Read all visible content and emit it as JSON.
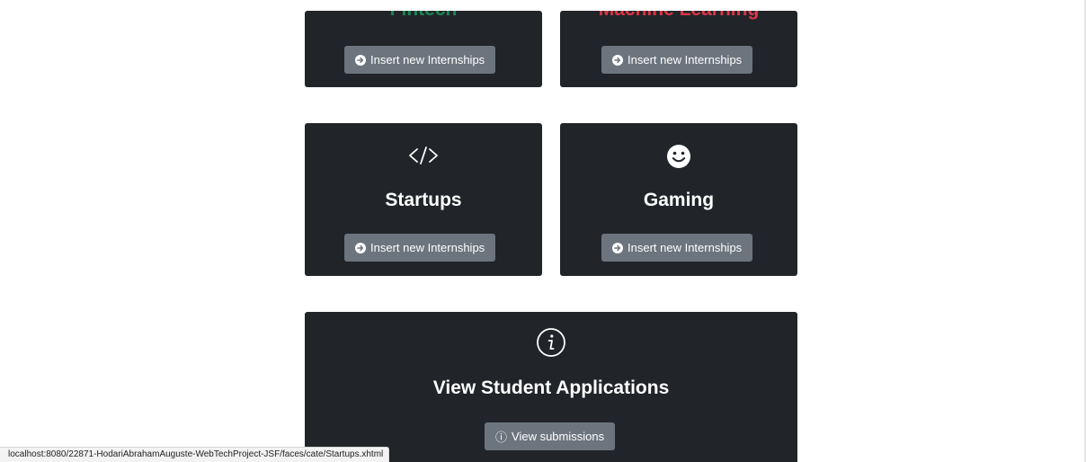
{
  "cards": {
    "fintech": {
      "title": "Fintech",
      "title_color": "#198754",
      "button_label": "Insert new Internships"
    },
    "machine_learning": {
      "title": "Machine Learning",
      "title_color": "#dc3545",
      "button_label": "Insert new Internships"
    },
    "startups": {
      "title": "Startups",
      "icon": "code-icon",
      "button_label": "Insert new Internships"
    },
    "gaming": {
      "title": "Gaming",
      "icon": "smiley-icon",
      "button_label": "Insert new Internships"
    },
    "applications": {
      "title": "View Student Applications",
      "icon": "info-icon",
      "button_label": "View submissions",
      "button_icon": "ⓘ"
    }
  },
  "colors": {
    "card_bg": "#212529",
    "button_bg": "#6c757d"
  },
  "status_bar": {
    "url": "localhost:8080/22871-HodariAbrahamAuguste-WebTechProject-JSF/faces/cate/Startups.xhtml"
  }
}
